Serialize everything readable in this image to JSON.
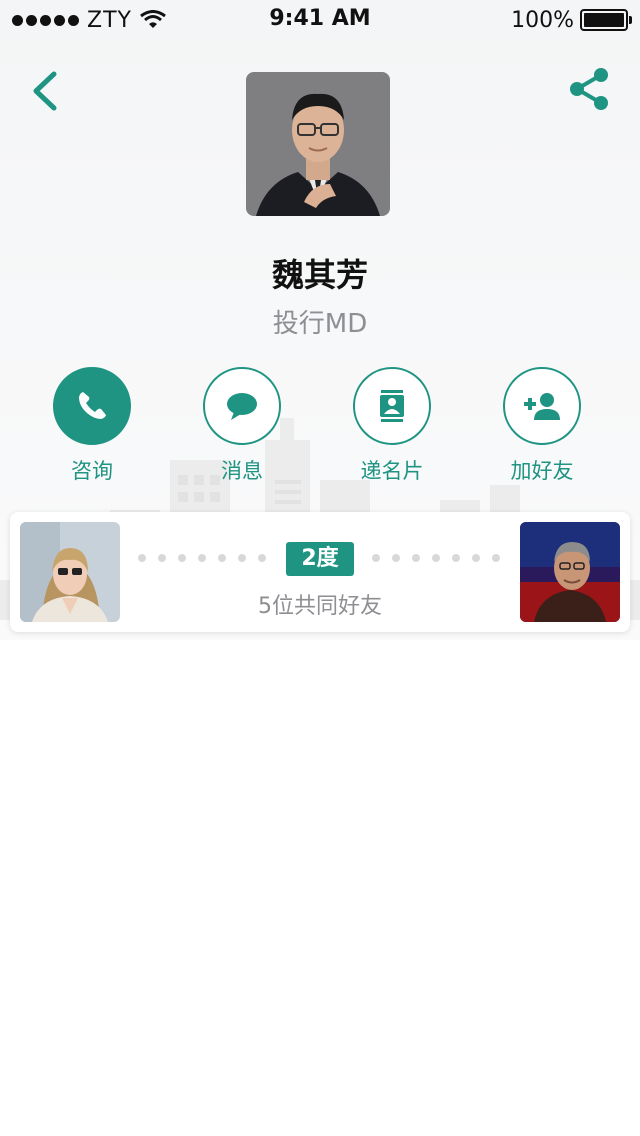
{
  "status_bar": {
    "carrier": "ZTY",
    "time": "9:41 AM",
    "battery": "100%",
    "battery_level": 1.0
  },
  "nav": {
    "back_icon": "chevron-left-icon",
    "share_icon": "share-icon",
    "accent_color": "#1f9483"
  },
  "profile": {
    "name": "魏其芳",
    "title": "投行MD"
  },
  "actions": [
    {
      "label": "咨询",
      "icon": "phone-icon"
    },
    {
      "label": "消息",
      "icon": "chat-bubble-icon"
    },
    {
      "label": "递名片",
      "icon": "contact-card-icon"
    },
    {
      "label": "加好友",
      "icon": "add-friend-icon"
    }
  ],
  "connection": {
    "degree": "2度",
    "mutual_friends": "5位共同好友"
  }
}
